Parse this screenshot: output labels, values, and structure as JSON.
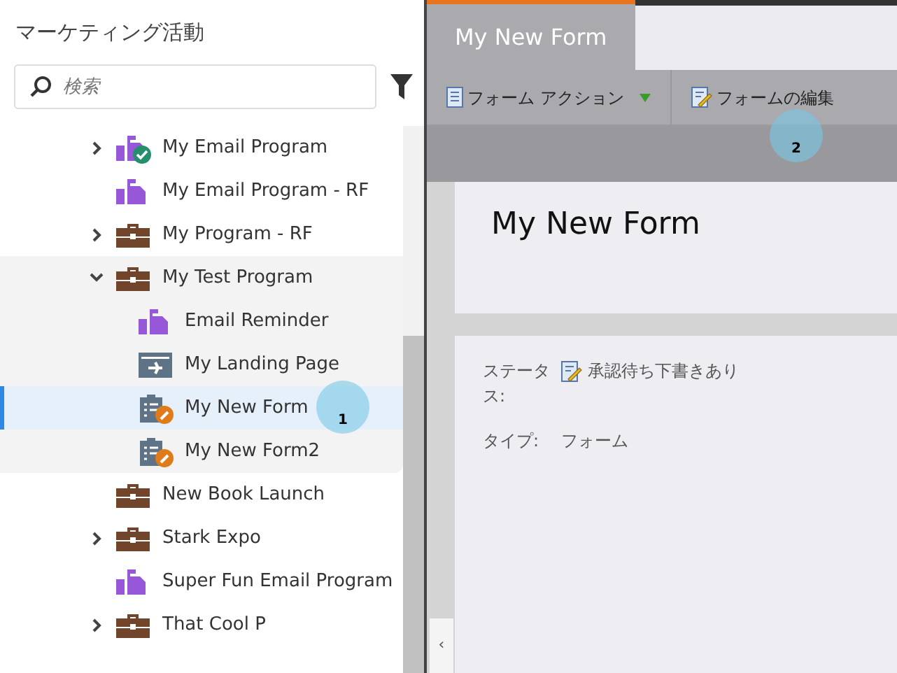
{
  "sidebar": {
    "title": "マーケティング活動",
    "search": {
      "placeholder": "検索"
    },
    "tree": [
      {
        "label": "My Email Program",
        "kind": "email-program",
        "approved": true,
        "draft": false,
        "expanded": false,
        "selected": false
      },
      {
        "label": "My Email Program - RF",
        "kind": "email-program",
        "approved": false,
        "draft": false,
        "selected": false
      },
      {
        "label": "My Program - RF",
        "kind": "program",
        "approved": false,
        "draft": false,
        "expanded": false,
        "selected": false
      },
      {
        "label": "My Test Program",
        "kind": "program",
        "approved": false,
        "draft": false,
        "expanded": true,
        "selected": false,
        "children": [
          {
            "label": "Email Reminder",
            "kind": "email",
            "approved": false,
            "draft": false,
            "selected": false
          },
          {
            "label": "My Landing Page",
            "kind": "landing-page",
            "approved": false,
            "draft": false,
            "selected": false
          },
          {
            "label": "My New Form",
            "kind": "form",
            "approved": false,
            "draft": true,
            "selected": true
          },
          {
            "label": "My New Form2",
            "kind": "form",
            "approved": false,
            "draft": true,
            "selected": false
          }
        ]
      },
      {
        "label": "New Book Launch",
        "kind": "program",
        "approved": false,
        "draft": false,
        "selected": false
      },
      {
        "label": "Stark Expo",
        "kind": "program",
        "approved": false,
        "draft": false,
        "expanded": false,
        "selected": false
      },
      {
        "label": "Super Fun Email Program",
        "kind": "email-program",
        "approved": false,
        "draft": false,
        "selected": false
      },
      {
        "label": "That Cool P",
        "kind": "program",
        "approved": false,
        "draft": false,
        "expanded": false,
        "selected": false
      }
    ]
  },
  "tabs": [
    {
      "label": "My New Form",
      "selected": true
    }
  ],
  "toolbar": [
    {
      "label": "フォーム アクション",
      "kind": "menu"
    },
    {
      "label": "フォームの編集",
      "kind": "edit"
    }
  ],
  "form": {
    "title": "My New Form",
    "fields": [
      {
        "label": "ステータス:",
        "value": "承認待ち下書きあり",
        "kind": "status"
      },
      {
        "label": "タイプ:",
        "value": "フォーム",
        "kind": "text"
      }
    ]
  },
  "collapse_button": "‹",
  "step_markers": [
    "1",
    "2"
  ]
}
